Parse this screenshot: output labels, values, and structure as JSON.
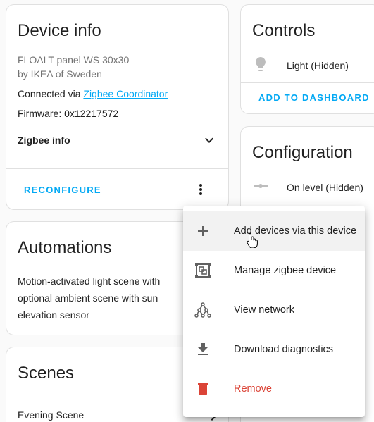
{
  "device_info": {
    "title": "Device info",
    "model": "FLOALT panel WS 30x30",
    "manufacturer": "by IKEA of Sweden",
    "connected_prefix": "Connected via ",
    "connected_link": "Zigbee Coordinator",
    "firmware": "Firmware: 0x12217572",
    "zigbee_info_label": "Zigbee info",
    "reconfigure_label": "RECONFIGURE"
  },
  "controls": {
    "title": "Controls",
    "entity_label": "Light (Hidden)",
    "add_to_dashboard_label": "ADD TO DASHBOARD"
  },
  "configuration": {
    "title": "Configuration",
    "entity_label": "On level (Hidden)"
  },
  "automations": {
    "title": "Automations",
    "item_line1": "Motion-activated light scene with",
    "item_line2": "optional ambient scene with sun",
    "item_line3": "elevation sensor"
  },
  "scenes": {
    "title": "Scenes",
    "item": "Evening Scene"
  },
  "menu": {
    "items": [
      {
        "label": "Add devices via this device",
        "icon": "plus-icon"
      },
      {
        "label": "Manage zigbee device",
        "icon": "manage-zigbee-icon"
      },
      {
        "label": "View network",
        "icon": "network-icon"
      },
      {
        "label": "Download diagnostics",
        "icon": "download-icon"
      },
      {
        "label": "Remove",
        "icon": "delete-icon"
      }
    ]
  },
  "colors": {
    "accent": "#03a9f4",
    "danger": "#db4437"
  }
}
